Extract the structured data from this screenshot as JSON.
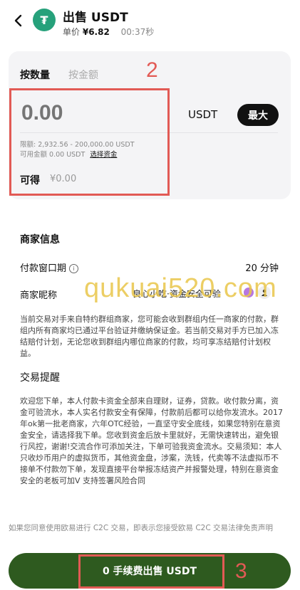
{
  "header": {
    "title": "出售 USDT",
    "price_label": "单价",
    "price_value": "¥6.82",
    "timer": "00:37秒"
  },
  "order_form": {
    "tab_quantity": "按数量",
    "tab_amount": "按金额",
    "amount_placeholder": "0.00",
    "unit": "USDT",
    "max_button": "最大",
    "limit_text": "限额: 2,932.56 - 200,000.00 USDT",
    "available_text": "可用金额 0.00 USDT",
    "select_funds_link": "选择资金",
    "receive_label": "可得",
    "receive_value": "¥0.00"
  },
  "annotations": {
    "box2_number": "2",
    "box3_number": "3"
  },
  "merchant": {
    "heading": "商家信息",
    "payment_window_label": "付款窗口期",
    "payment_window_value": "20 分钟",
    "nickname_label": "商家昵称",
    "nickname_value": "良心小吃·资金安全可验",
    "description": "当前交易对手来自特约群组商家，您可能会收到群组内任一商家的付款，群组内所有商家均已通过平台验证并缴纳保证金。若当前交易对手方已加入冻结赔付计划，无论您收到群组内哪位商家的付款，均可享冻结赔付计划权益。",
    "tips_heading": "交易提醒",
    "tips_text": "欢迎您下单，本人付款卡资金全部来自理财，证券，贷款。收付款分离，资金可验流水，本人实名付款安全有保障，付款前后都可以给你发流水。2017年ok第一批老商家，六年OTC经验，一直坚守安全底线，如果您特别在意资金安全，请选择我下单。您收到资金后放卡里就好，无需快速转出，避免银行风控，谢谢!交流合作可添加关注，下单可验我资金流水。交易须知：本人只收炒币用户的虚拟货币，其他资金盘，涉案，洗钱，代卖等不法虚拟币不接单不付款勿下单，发现直接平台举报冻结资产并报警处理，特别在意资金安全的老板可加V 支持签署风险合同"
  },
  "disclaimer": "如果您同意使用欧易进行 C2C 交易，即表示您接受欧易 C2C 交易法律免责声明",
  "footer": {
    "sell_button": "0 手续费出售 USDT"
  },
  "watermark": "qukuai520.com",
  "colors": {
    "annotation_red": "#e25a55",
    "button_green": "#2e5a1f",
    "tether_green": "#26a17b"
  },
  "icons": [
    "back-arrow-icon",
    "tether-logo-icon",
    "info-icon",
    "gem-icon",
    "user-icon"
  ]
}
